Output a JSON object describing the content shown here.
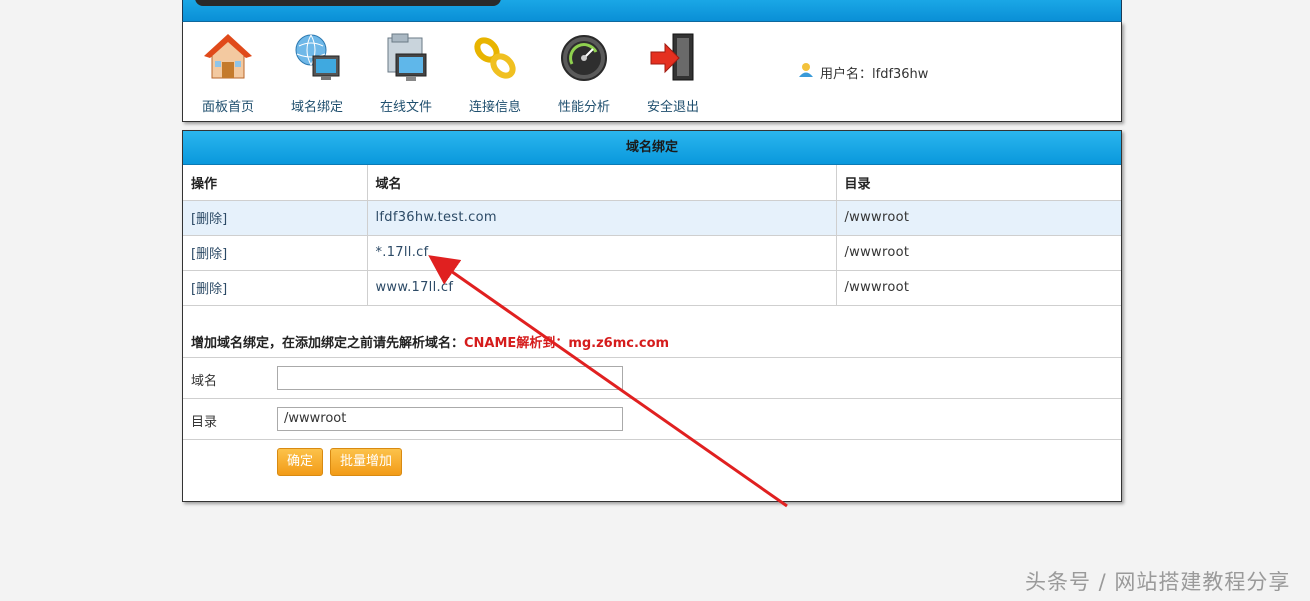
{
  "toolbar": {
    "items": [
      {
        "label": "面板首页",
        "icon": "home-icon"
      },
      {
        "label": "域名绑定",
        "icon": "globe-monitor-icon"
      },
      {
        "label": "在线文件",
        "icon": "folder-monitor-icon"
      },
      {
        "label": "连接信息",
        "icon": "link-chain-icon"
      },
      {
        "label": "性能分析",
        "icon": "gauge-icon"
      },
      {
        "label": "安全退出",
        "icon": "exit-door-icon"
      }
    ],
    "user_text": "用户名：lfdf36hw"
  },
  "panel": {
    "title": "域名绑定",
    "columns": [
      "操作",
      "域名",
      "目录"
    ],
    "rows": [
      {
        "action": "[删除]",
        "domain": "lfdf36hw.test.com",
        "dir": "/wwwroot"
      },
      {
        "action": "[删除]",
        "domain": "*.17ll.cf",
        "dir": "/wwwroot"
      },
      {
        "action": "[删除]",
        "domain": "www.17ll.cf",
        "dir": "/wwwroot"
      }
    ],
    "add_note": "增加域名绑定，在添加绑定之前请先解析域名：",
    "add_note_red": "CNAME解析到：mg.z6mc.com",
    "form": {
      "domain_label": "域名",
      "domain_value": "",
      "dir_label": "目录",
      "dir_value": "/wwwroot"
    },
    "buttons": {
      "confirm": "确定",
      "batch_add": "批量增加"
    }
  },
  "annotation_color": "#e02020",
  "watermark": "头条号 / 网站搭建教程分享"
}
